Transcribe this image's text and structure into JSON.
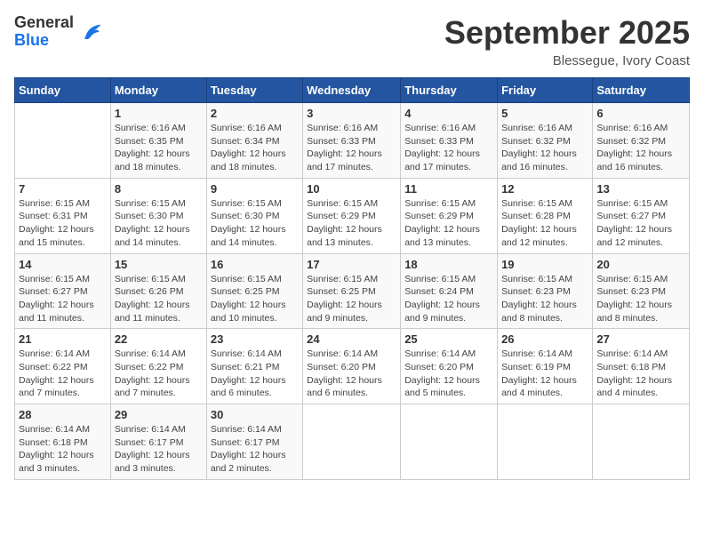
{
  "logo": {
    "general": "General",
    "blue": "Blue"
  },
  "header": {
    "month": "September 2025",
    "location": "Blessegue, Ivory Coast"
  },
  "weekdays": [
    "Sunday",
    "Monday",
    "Tuesday",
    "Wednesday",
    "Thursday",
    "Friday",
    "Saturday"
  ],
  "weeks": [
    [
      {
        "num": "",
        "sunrise": "",
        "sunset": "",
        "daylight": ""
      },
      {
        "num": "1",
        "sunrise": "6:16 AM",
        "sunset": "6:35 PM",
        "hours": "12 hours",
        "minutes": "and 18 minutes."
      },
      {
        "num": "2",
        "sunrise": "6:16 AM",
        "sunset": "6:34 PM",
        "hours": "12 hours",
        "minutes": "and 18 minutes."
      },
      {
        "num": "3",
        "sunrise": "6:16 AM",
        "sunset": "6:33 PM",
        "hours": "12 hours",
        "minutes": "and 17 minutes."
      },
      {
        "num": "4",
        "sunrise": "6:16 AM",
        "sunset": "6:33 PM",
        "hours": "12 hours",
        "minutes": "and 17 minutes."
      },
      {
        "num": "5",
        "sunrise": "6:16 AM",
        "sunset": "6:32 PM",
        "hours": "12 hours",
        "minutes": "and 16 minutes."
      },
      {
        "num": "6",
        "sunrise": "6:16 AM",
        "sunset": "6:32 PM",
        "hours": "12 hours",
        "minutes": "and 16 minutes."
      }
    ],
    [
      {
        "num": "7",
        "sunrise": "6:15 AM",
        "sunset": "6:31 PM",
        "hours": "12 hours",
        "minutes": "and 15 minutes."
      },
      {
        "num": "8",
        "sunrise": "6:15 AM",
        "sunset": "6:30 PM",
        "hours": "12 hours",
        "minutes": "and 14 minutes."
      },
      {
        "num": "9",
        "sunrise": "6:15 AM",
        "sunset": "6:30 PM",
        "hours": "12 hours",
        "minutes": "and 14 minutes."
      },
      {
        "num": "10",
        "sunrise": "6:15 AM",
        "sunset": "6:29 PM",
        "hours": "12 hours",
        "minutes": "and 13 minutes."
      },
      {
        "num": "11",
        "sunrise": "6:15 AM",
        "sunset": "6:29 PM",
        "hours": "12 hours",
        "minutes": "and 13 minutes."
      },
      {
        "num": "12",
        "sunrise": "6:15 AM",
        "sunset": "6:28 PM",
        "hours": "12 hours",
        "minutes": "and 12 minutes."
      },
      {
        "num": "13",
        "sunrise": "6:15 AM",
        "sunset": "6:27 PM",
        "hours": "12 hours",
        "minutes": "and 12 minutes."
      }
    ],
    [
      {
        "num": "14",
        "sunrise": "6:15 AM",
        "sunset": "6:27 PM",
        "hours": "12 hours",
        "minutes": "and 11 minutes."
      },
      {
        "num": "15",
        "sunrise": "6:15 AM",
        "sunset": "6:26 PM",
        "hours": "12 hours",
        "minutes": "and 11 minutes."
      },
      {
        "num": "16",
        "sunrise": "6:15 AM",
        "sunset": "6:25 PM",
        "hours": "12 hours",
        "minutes": "and 10 minutes."
      },
      {
        "num": "17",
        "sunrise": "6:15 AM",
        "sunset": "6:25 PM",
        "hours": "12 hours",
        "minutes": "and 9 minutes."
      },
      {
        "num": "18",
        "sunrise": "6:15 AM",
        "sunset": "6:24 PM",
        "hours": "12 hours",
        "minutes": "and 9 minutes."
      },
      {
        "num": "19",
        "sunrise": "6:15 AM",
        "sunset": "6:23 PM",
        "hours": "12 hours",
        "minutes": "and 8 minutes."
      },
      {
        "num": "20",
        "sunrise": "6:15 AM",
        "sunset": "6:23 PM",
        "hours": "12 hours",
        "minutes": "and 8 minutes."
      }
    ],
    [
      {
        "num": "21",
        "sunrise": "6:14 AM",
        "sunset": "6:22 PM",
        "hours": "12 hours",
        "minutes": "and 7 minutes."
      },
      {
        "num": "22",
        "sunrise": "6:14 AM",
        "sunset": "6:22 PM",
        "hours": "12 hours",
        "minutes": "and 7 minutes."
      },
      {
        "num": "23",
        "sunrise": "6:14 AM",
        "sunset": "6:21 PM",
        "hours": "12 hours",
        "minutes": "and 6 minutes."
      },
      {
        "num": "24",
        "sunrise": "6:14 AM",
        "sunset": "6:20 PM",
        "hours": "12 hours",
        "minutes": "and 6 minutes."
      },
      {
        "num": "25",
        "sunrise": "6:14 AM",
        "sunset": "6:20 PM",
        "hours": "12 hours",
        "minutes": "and 5 minutes."
      },
      {
        "num": "26",
        "sunrise": "6:14 AM",
        "sunset": "6:19 PM",
        "hours": "12 hours",
        "minutes": "and 4 minutes."
      },
      {
        "num": "27",
        "sunrise": "6:14 AM",
        "sunset": "6:18 PM",
        "hours": "12 hours",
        "minutes": "and 4 minutes."
      }
    ],
    [
      {
        "num": "28",
        "sunrise": "6:14 AM",
        "sunset": "6:18 PM",
        "hours": "12 hours",
        "minutes": "and 3 minutes."
      },
      {
        "num": "29",
        "sunrise": "6:14 AM",
        "sunset": "6:17 PM",
        "hours": "12 hours",
        "minutes": "and 3 minutes."
      },
      {
        "num": "30",
        "sunrise": "6:14 AM",
        "sunset": "6:17 PM",
        "hours": "12 hours",
        "minutes": "and 2 minutes."
      },
      {
        "num": "",
        "sunrise": "",
        "sunset": "",
        "hours": "",
        "minutes": ""
      },
      {
        "num": "",
        "sunrise": "",
        "sunset": "",
        "hours": "",
        "minutes": ""
      },
      {
        "num": "",
        "sunrise": "",
        "sunset": "",
        "hours": "",
        "minutes": ""
      },
      {
        "num": "",
        "sunrise": "",
        "sunset": "",
        "hours": "",
        "minutes": ""
      }
    ]
  ]
}
